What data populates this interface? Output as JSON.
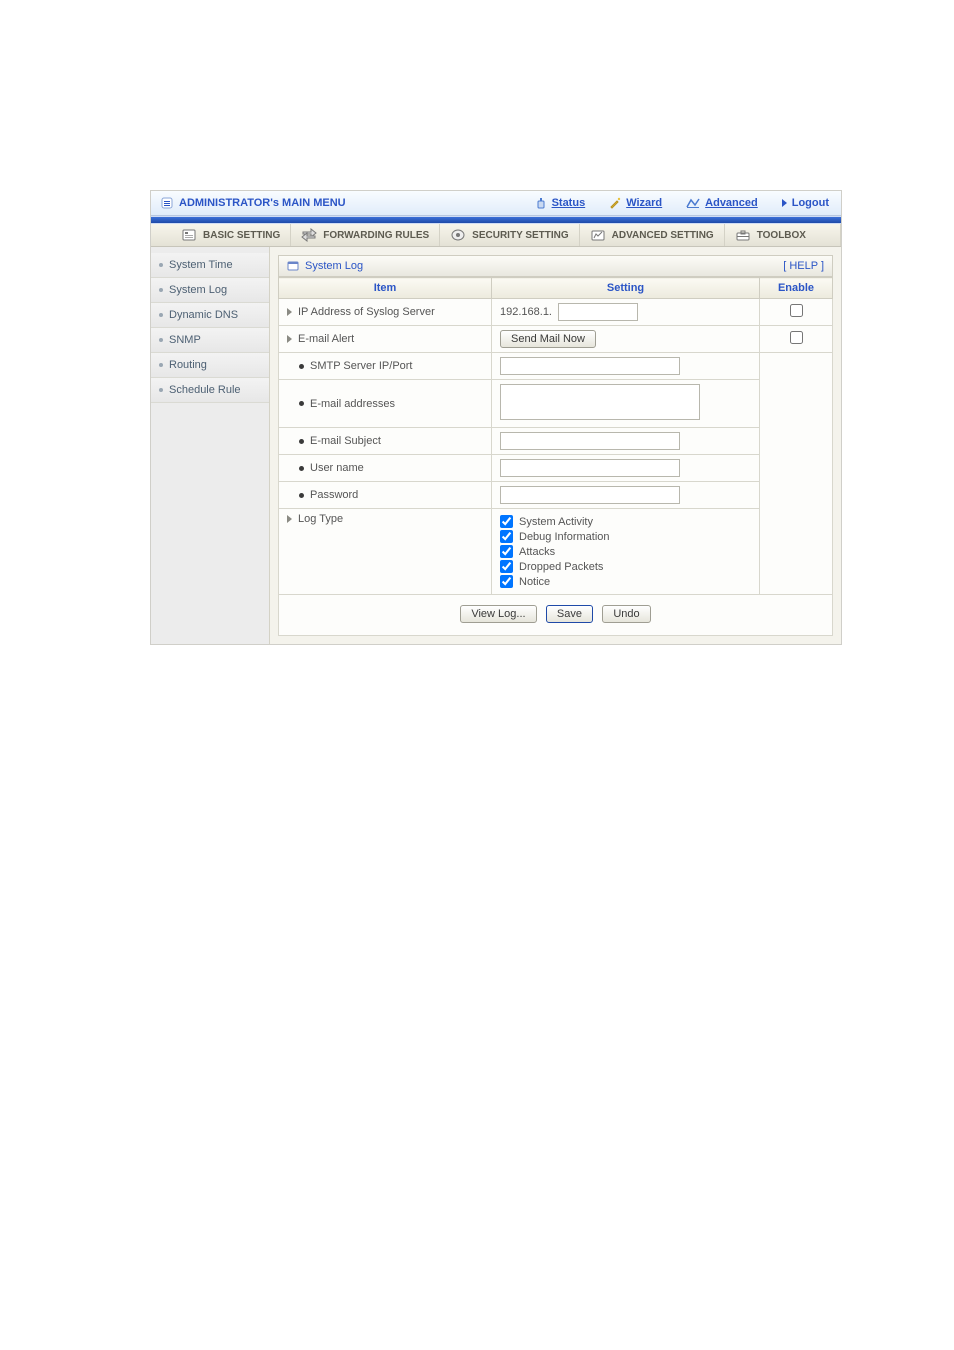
{
  "top": {
    "main_menu": "ADMINISTRATOR's MAIN MENU",
    "links": {
      "status": "Status",
      "wizard": "Wizard",
      "advanced": "Advanced",
      "logout": "Logout"
    }
  },
  "tabs": {
    "basic": "BASIC SETTING",
    "forward": "FORWARDING RULES",
    "security": "SECURITY SETTING",
    "advanced": "ADVANCED SETTING",
    "toolbox": "TOOLBOX"
  },
  "sidebar": [
    "System Time",
    "System Log",
    "Dynamic DNS",
    "SNMP",
    "Routing",
    "Schedule Rule"
  ],
  "panel": {
    "title": "System Log",
    "help": "[ HELP ]"
  },
  "headers": {
    "item": "Item",
    "setting": "Setting",
    "enable": "Enable"
  },
  "rows": {
    "ip_label": "IP Address of Syslog Server",
    "ip_prefix": "192.168.1.",
    "ip_value": "",
    "email_label": "E-mail Alert",
    "send_mail_btn": "Send Mail Now",
    "smtp_label": "SMTP Server IP/Port",
    "smtp_value": "",
    "addr_label": "E-mail addresses",
    "addr_value": "",
    "subj_label": "E-mail Subject",
    "subj_value": "",
    "user_label": "User name",
    "user_value": "",
    "pass_label": "Password",
    "pass_value": "",
    "logtype_label": "Log Type"
  },
  "logtypes": [
    "System Activity",
    "Debug Information",
    "Attacks",
    "Dropped Packets",
    "Notice"
  ],
  "actions": {
    "view": "View Log...",
    "save": "Save",
    "undo": "Undo"
  }
}
